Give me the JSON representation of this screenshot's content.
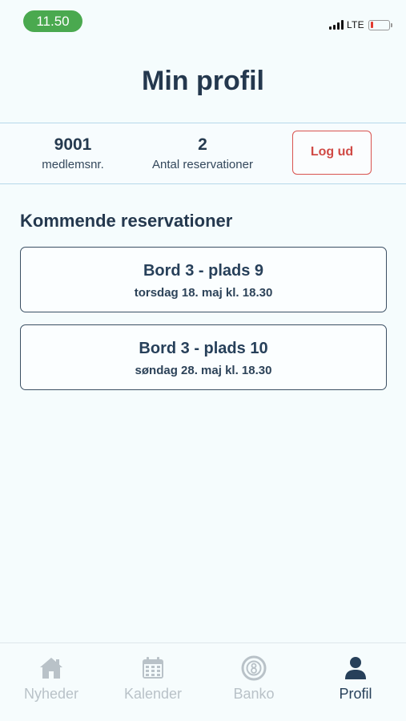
{
  "status_bar": {
    "time": "11.50",
    "network": "LTE",
    "icons": [
      "signal-icon",
      "battery-icon"
    ],
    "battery_level": 0.12,
    "colors": {
      "time_pill": "#4aa94f",
      "battery_low": "#e23a30"
    }
  },
  "header": {
    "title": "Min profil"
  },
  "stats": {
    "member_number": "9001",
    "member_label": "medlemsnr.",
    "reservations_count": "2",
    "reservations_label": "Antal reservationer",
    "logout_label": "Log ud"
  },
  "upcoming": {
    "title": "Kommende reservationer",
    "items": [
      {
        "seat": "Bord 3 - plads 9",
        "when": "torsdag 18. maj kl. 18.30"
      },
      {
        "seat": "Bord 3 - plads 10",
        "when": "søndag 28. maj kl. 18.30"
      }
    ]
  },
  "tab_bar": {
    "tabs": [
      {
        "label": "Nyheder",
        "icon": "home-icon",
        "active": false
      },
      {
        "label": "Kalender",
        "icon": "calendar-icon",
        "active": false
      },
      {
        "label": "Banko",
        "icon": "bingo-ball-icon",
        "active": false
      },
      {
        "label": "Profil",
        "icon": "person-icon",
        "active": true
      }
    ],
    "colors": {
      "active": "#27405a",
      "inactive": "#b9c2c8"
    }
  }
}
